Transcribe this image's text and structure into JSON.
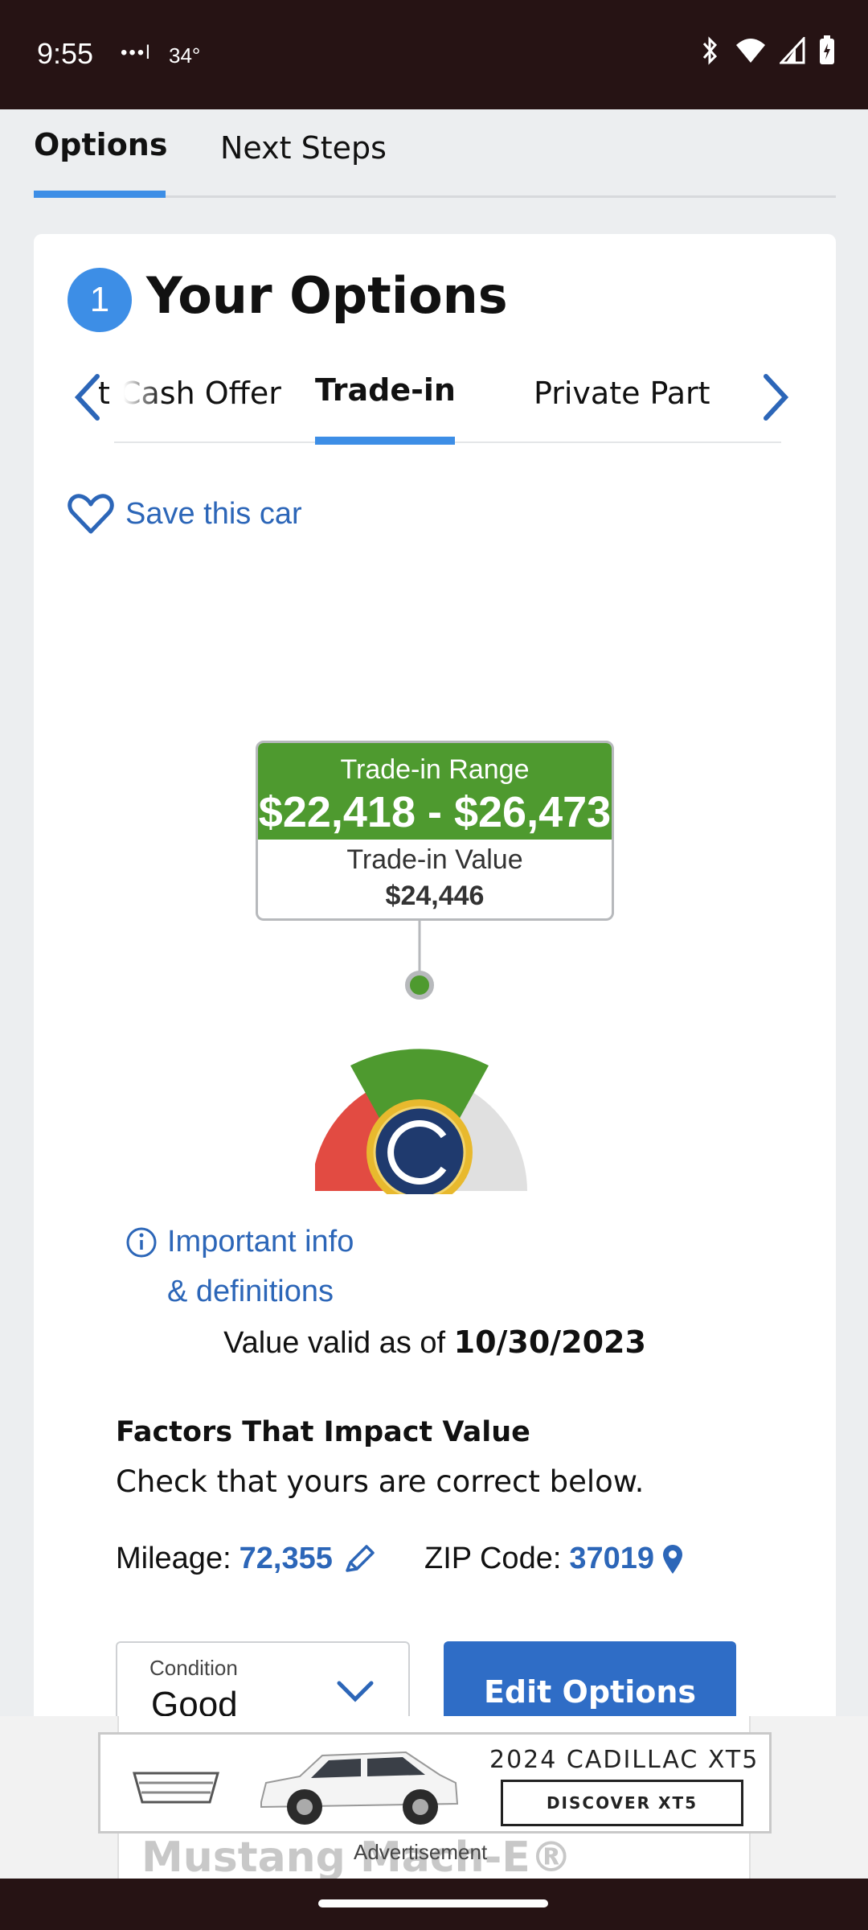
{
  "status_bar": {
    "time": "9:55",
    "dots": "•••l",
    "temperature": "34°"
  },
  "top_tabs": {
    "options": "Options",
    "next_steps": "Next Steps"
  },
  "card": {
    "step_number": "1",
    "title": "Your Options",
    "subtabs": {
      "cash_offer": "t Cash Offer",
      "trade_in": "Trade-in",
      "private_party": "Private Part"
    },
    "save_label": "Save this car"
  },
  "callout": {
    "range_label": "Trade-in Range",
    "range": "$22,418 - $26,473",
    "value_label": "Trade-in Value",
    "value": "$24,446"
  },
  "info": {
    "line1": "Important info",
    "line2": "& definitions"
  },
  "valid": {
    "prefix": "Value valid as of",
    "date": "10/30/2023"
  },
  "factors": {
    "title": "Factors That Impact Value",
    "subtitle": "Check that yours are correct below.",
    "mileage_label": "Mileage:",
    "mileage_value": "72,355",
    "zip_label": "ZIP Code:",
    "zip_value": "37019"
  },
  "condition": {
    "label": "Condition",
    "value": "Good"
  },
  "edit_button": "Edit Options",
  "ad": {
    "headline": "2024 CADILLAC XT5",
    "cta": "DISCOVER XT5",
    "label": "Advertisement",
    "underlying_text": "Mustang Mach-E®"
  },
  "colors": {
    "accent": "#3d8ee6",
    "link": "#2c66b8",
    "green": "#4e9a2f",
    "red": "#e24b42",
    "navy": "#1f3a6e"
  }
}
